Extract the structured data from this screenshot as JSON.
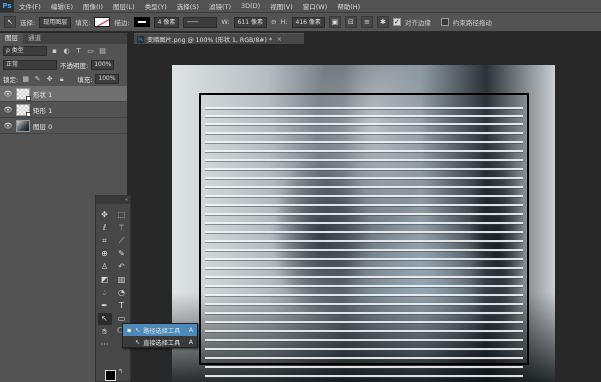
{
  "app": {
    "logo": "Ps"
  },
  "menu": [
    "文件(F)",
    "编辑(E)",
    "图像(I)",
    "图层(L)",
    "类型(Y)",
    "选择(S)",
    "滤镜(T)",
    "3D(D)",
    "视图(V)",
    "窗口(W)",
    "帮助(H)"
  ],
  "options": {
    "tool_icon": "path-selection-icon",
    "select_label": "选择:",
    "select_value": "现用图层",
    "fill_label": "填充:",
    "stroke_label": "描边:",
    "stroke_width": "4 像素",
    "w_label": "W:",
    "w_value": "611 像素",
    "link_icon": "link-icon",
    "h_label": "H:",
    "h_value": "416 像素",
    "align_edges_label": "对齐边缘",
    "constrain_label": "约束路径拖动",
    "align_edges_checked": true,
    "constrain_checked": false
  },
  "panel": {
    "tabs": [
      "图层",
      "通道"
    ],
    "filter_kind": "ρ 类型",
    "blend_mode": "正常",
    "opacity_label": "不透明度:",
    "opacity_value": "100%",
    "lock_label": "锁定:",
    "fill_label": "填充:",
    "fill_value": "100%",
    "layers": [
      {
        "name": "形状 1",
        "selected": true,
        "kind": "shape"
      },
      {
        "name": "矩形 1",
        "selected": false,
        "kind": "shape"
      },
      {
        "name": "图层 0",
        "selected": false,
        "kind": "photo"
      }
    ]
  },
  "document": {
    "tab_title": "变暗图片.png @ 100% (形状 1, RGB/8#) *",
    "close_glyph": "×"
  },
  "canvas": {
    "stripe_color": "#f2f4f5",
    "border_color": "#000000"
  },
  "tools": {
    "collapse_glyph": "«",
    "icons": [
      "move-icon",
      "marquee-icon",
      "lasso-icon",
      "magic-wand-icon",
      "crop-icon",
      "eyedropper-icon",
      "healing-icon",
      "brush-icon",
      "stamp-icon",
      "history-brush-icon",
      "eraser-icon",
      "gradient-icon",
      "blur-icon",
      "dodge-icon",
      "pen-icon",
      "type-icon",
      "path-selection-icon",
      "shape-icon",
      "hand-icon",
      "zoom-icon"
    ],
    "extra": "···"
  },
  "flyout": {
    "items": [
      {
        "label": "路径选择工具",
        "key": "A",
        "active": true
      },
      {
        "label": "直接选择工具",
        "key": "A",
        "active": false
      }
    ]
  }
}
